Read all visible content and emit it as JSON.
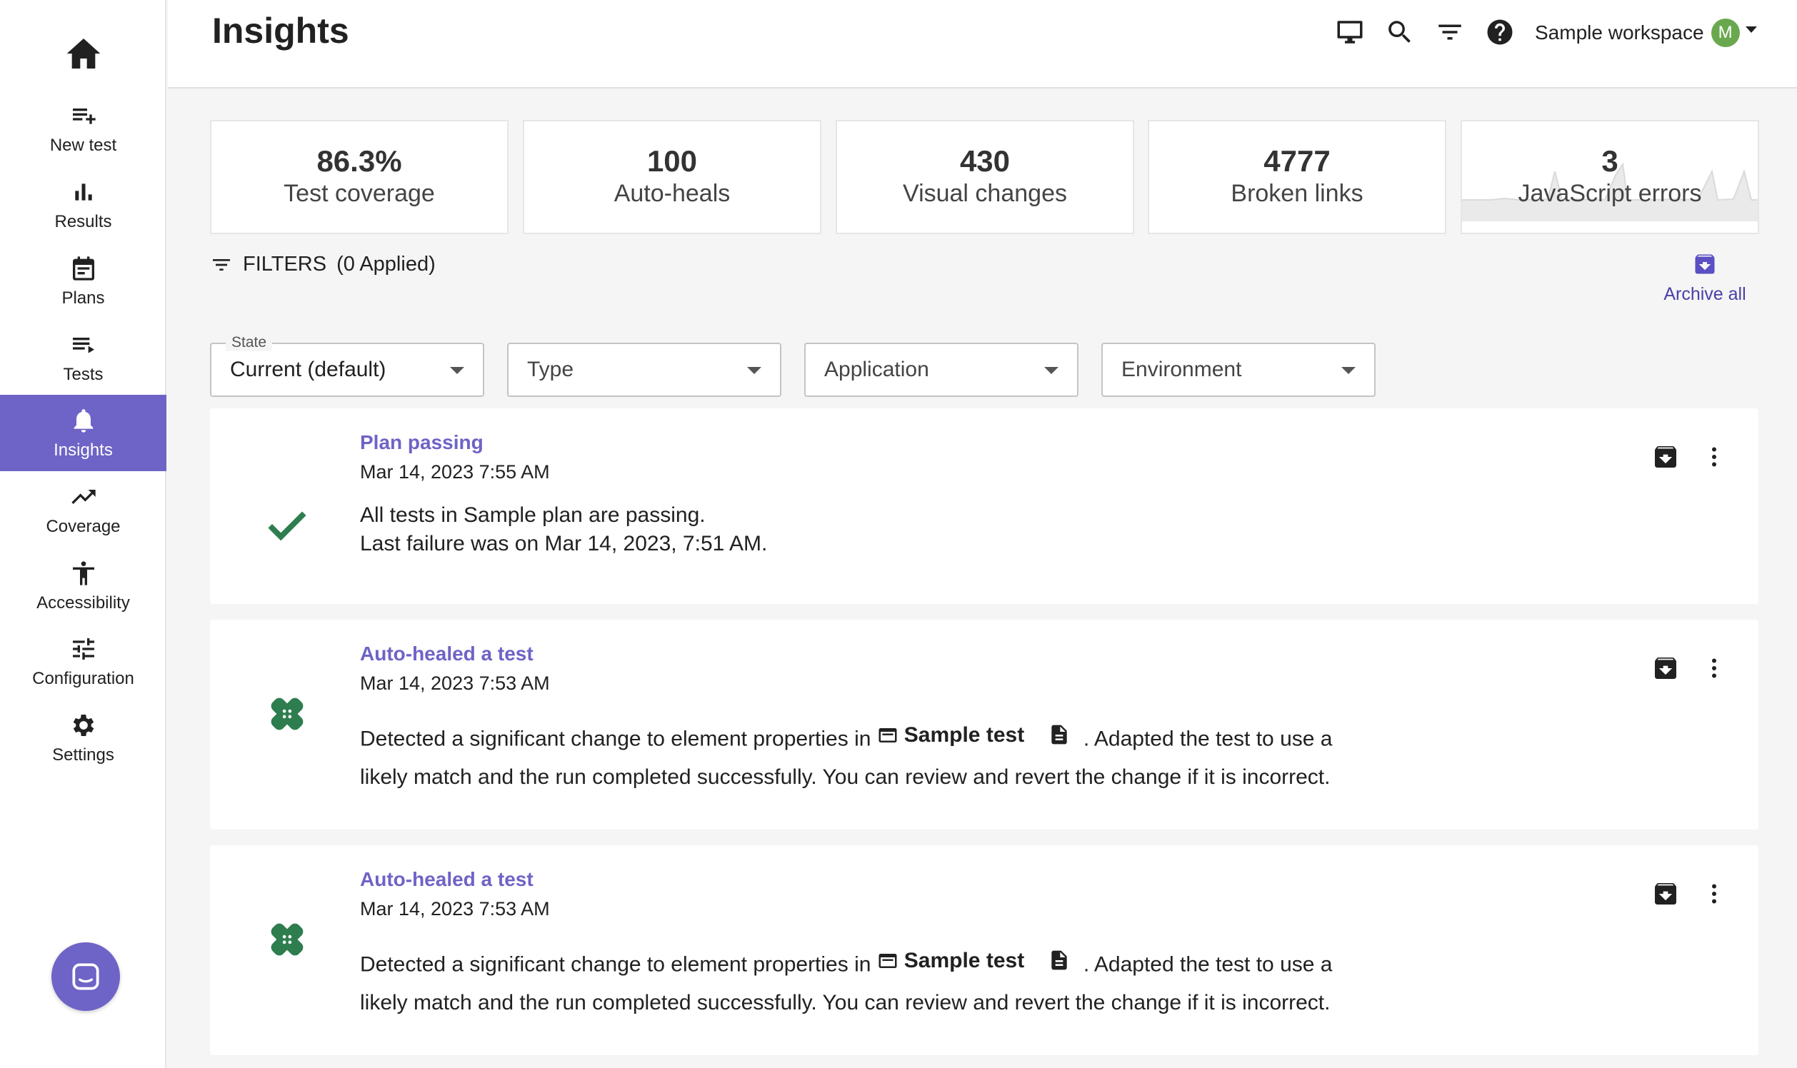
{
  "sidebar": {
    "items": [
      {
        "label": "New test",
        "icon": "playlist-add-icon"
      },
      {
        "label": "Results",
        "icon": "bar-chart-icon"
      },
      {
        "label": "Plans",
        "icon": "calendar-icon"
      },
      {
        "label": "Tests",
        "icon": "list-icon"
      },
      {
        "label": "Insights",
        "icon": "bell-icon",
        "active": true
      },
      {
        "label": "Coverage",
        "icon": "trending-up-icon"
      },
      {
        "label": "Accessibility",
        "icon": "accessibility-icon"
      },
      {
        "label": "Configuration",
        "icon": "tune-icon"
      },
      {
        "label": "Settings",
        "icon": "gear-icon"
      }
    ]
  },
  "header": {
    "title": "Insights",
    "workspace_name": "Sample workspace",
    "workspace_initial": "M"
  },
  "stats": [
    {
      "value": "86.3%",
      "label": "Test coverage"
    },
    {
      "value": "100",
      "label": "Auto-heals"
    },
    {
      "value": "430",
      "label": "Visual changes"
    },
    {
      "value": "4777",
      "label": "Broken links"
    },
    {
      "value": "3",
      "label": "JavaScript errors"
    }
  ],
  "filters": {
    "toggle_label": "FILTERS",
    "applied_label": "(0 Applied)",
    "archive_all_label": "Archive all",
    "selects": [
      {
        "float_label": "State",
        "value": "Current (default)"
      },
      {
        "value": "Type"
      },
      {
        "value": "Application"
      },
      {
        "value": "Environment"
      }
    ]
  },
  "insights": [
    {
      "title": "Plan passing",
      "date": "Mar 14, 2023 7:55 AM",
      "line1": "All tests in Sample plan are passing.",
      "line2": "Last failure was on Mar 14, 2023, 7:51 AM."
    },
    {
      "title": "Auto-healed a test",
      "date": "Mar 14, 2023 7:53 AM",
      "pre": "Detected a significant change to element properties in",
      "test_name": "Sample test",
      "post": ". Adapted the test to use a likely match and the run completed successfully. You can review and revert the change if it is incorrect."
    },
    {
      "title": "Auto-healed a test",
      "date": "Mar 14, 2023 7:53 AM",
      "pre": "Detected a significant change to element properties in",
      "test_name": "Sample test",
      "post": ". Adapted the test to use a likely match and the run completed successfully. You can review and revert the change if it is incorrect."
    }
  ],
  "colors": {
    "accent": "#6e63c6",
    "success": "#2e7d4f",
    "avatar": "#6aa84f"
  }
}
